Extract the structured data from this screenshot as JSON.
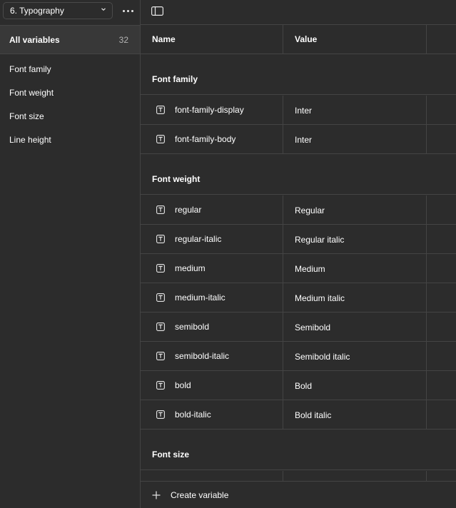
{
  "sidebar": {
    "collection": "6. Typography",
    "all_variables": {
      "label": "All variables",
      "count": "32"
    },
    "groups": [
      {
        "label": "Font family"
      },
      {
        "label": "Font weight"
      },
      {
        "label": "Font size"
      },
      {
        "label": "Line height"
      }
    ]
  },
  "table": {
    "headers": {
      "name": "Name",
      "value": "Value"
    },
    "sections": [
      {
        "title": "Font family",
        "rows": [
          {
            "name": "font-family-display",
            "value": "Inter"
          },
          {
            "name": "font-family-body",
            "value": "Inter"
          }
        ]
      },
      {
        "title": "Font weight",
        "rows": [
          {
            "name": "regular",
            "value": "Regular"
          },
          {
            "name": "regular-italic",
            "value": "Regular italic"
          },
          {
            "name": "medium",
            "value": "Medium"
          },
          {
            "name": "medium-italic",
            "value": "Medium italic"
          },
          {
            "name": "semibold",
            "value": "Semibold"
          },
          {
            "name": "semibold-italic",
            "value": "Semibold italic"
          },
          {
            "name": "bold",
            "value": "Bold"
          },
          {
            "name": "bold-italic",
            "value": "Bold italic"
          }
        ]
      },
      {
        "title": "Font size",
        "rows": []
      }
    ]
  },
  "footer": {
    "create_label": "Create variable"
  },
  "icons": {
    "collection_chevron": "chevron-down-icon",
    "more": "more-horizontal-icon",
    "panel_toggle": "sidebar-toggle-icon",
    "row_type": "string-type-icon",
    "create": "plus-icon"
  },
  "colors": {
    "background": "#2c2c2c",
    "selected": "#383838",
    "border": "#444444",
    "muted_text": "#b3b3b3"
  }
}
